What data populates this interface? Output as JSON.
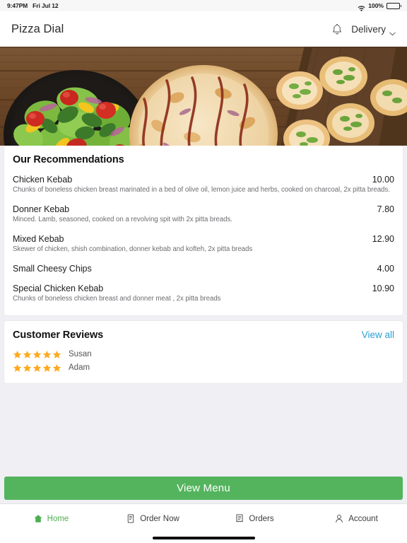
{
  "status_bar": {
    "time": "9:47PM",
    "date": "Fri Jul 12",
    "battery_percent": "100%",
    "wifi_icon": "wifi-icon",
    "battery_icon": "battery-full-icon"
  },
  "header": {
    "app_title": "Pizza Dial",
    "bell_icon": "bell-icon",
    "delivery_label": "Delivery",
    "chevron_icon": "chevron-down-icon"
  },
  "hero": {
    "alt": "salad bowl, bbq pizza and garlic bread on wooden table"
  },
  "recommendations": {
    "title": "Our Recommendations",
    "items": [
      {
        "name": "Chicken Kebab",
        "price": "10.00",
        "description": "Chunks of boneless chicken breast marinated in a bed of olive oil, lemon juice and herbs, cooked on charcoal, 2x pitta breads."
      },
      {
        "name": "Donner Kebab",
        "price": "7.80",
        "description": "Minced. Lamb, seasoned, cooked on a revolving spit with 2x pitta breads."
      },
      {
        "name": "Mixed Kebab",
        "price": "12.90",
        "description": "Skewer of chicken, shish combination, donner kebab and kofteh, 2x pitta breads"
      },
      {
        "name": "Small Cheesy Chips",
        "price": "4.00",
        "description": ""
      },
      {
        "name": "Special Chicken Kebab",
        "price": "10.90",
        "description": "Chunks of boneless chicken breast and donner meat , 2x pitta breads"
      }
    ]
  },
  "reviews": {
    "title": "Customer Reviews",
    "view_all_label": "View all",
    "entries": [
      {
        "name": "Susan",
        "rating": 5
      },
      {
        "name": "Adam",
        "rating": 5
      }
    ]
  },
  "cta": {
    "label": "View Menu"
  },
  "tabbar": {
    "tabs": [
      {
        "label": "Home",
        "icon": "home-icon",
        "active": true
      },
      {
        "label": "Order Now",
        "icon": "document-icon",
        "active": false
      },
      {
        "label": "Orders",
        "icon": "receipt-icon",
        "active": false
      },
      {
        "label": "Account",
        "icon": "person-icon",
        "active": false
      }
    ]
  },
  "colors": {
    "accent_green": "#54b45e",
    "tab_active": "#4caf50",
    "link_blue": "#2b9fd4",
    "star_amber": "#FFA91E",
    "page_bg": "#efeff4"
  }
}
